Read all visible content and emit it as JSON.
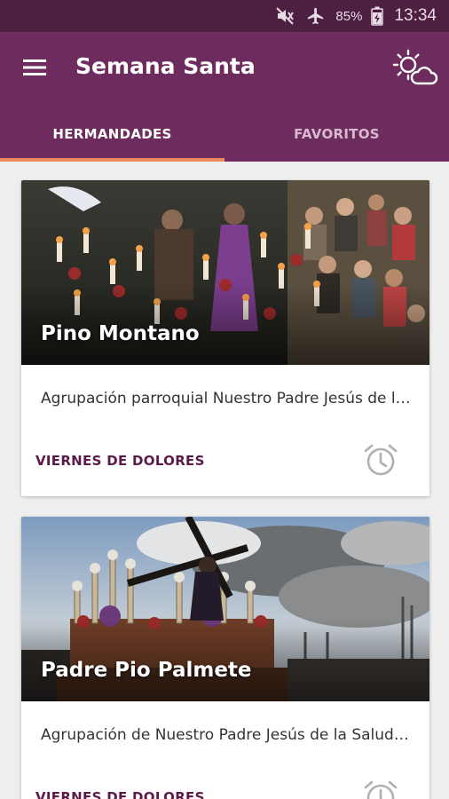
{
  "status_bar": {
    "battery_percent": "85%",
    "time": "13:34",
    "icons": [
      "mute-icon",
      "airplane-mode-icon",
      "battery-charging-icon"
    ]
  },
  "app_bar": {
    "title": "Semana Santa",
    "menu_icon": "hamburger-menu-icon",
    "weather_icon": "weather-sun-cloud-icon"
  },
  "tabs": [
    {
      "label": "HERMANDADES",
      "active": true
    },
    {
      "label": "FAVORITOS",
      "active": false
    }
  ],
  "cards": [
    {
      "name": "Pino Montano",
      "description": "Agrupación parroquial Nuestro Padre Jesús de la Salud",
      "day": "VIERNES DE DOLORES",
      "alarm_icon": "alarm-clock-icon"
    },
    {
      "name": "Padre Pio Palmete",
      "description": "Agrupación de Nuestro Padre Jesús de la Salud y Buen Viaje",
      "day": "VIERNES DE DOLORES",
      "alarm_icon": "alarm-clock-icon"
    }
  ],
  "colors": {
    "status_bar": "#4d1f40",
    "primary": "#6d2c5d",
    "tab_indicator": "#f08a5d",
    "day_text": "#5b1a49",
    "background": "#eeeeee"
  }
}
